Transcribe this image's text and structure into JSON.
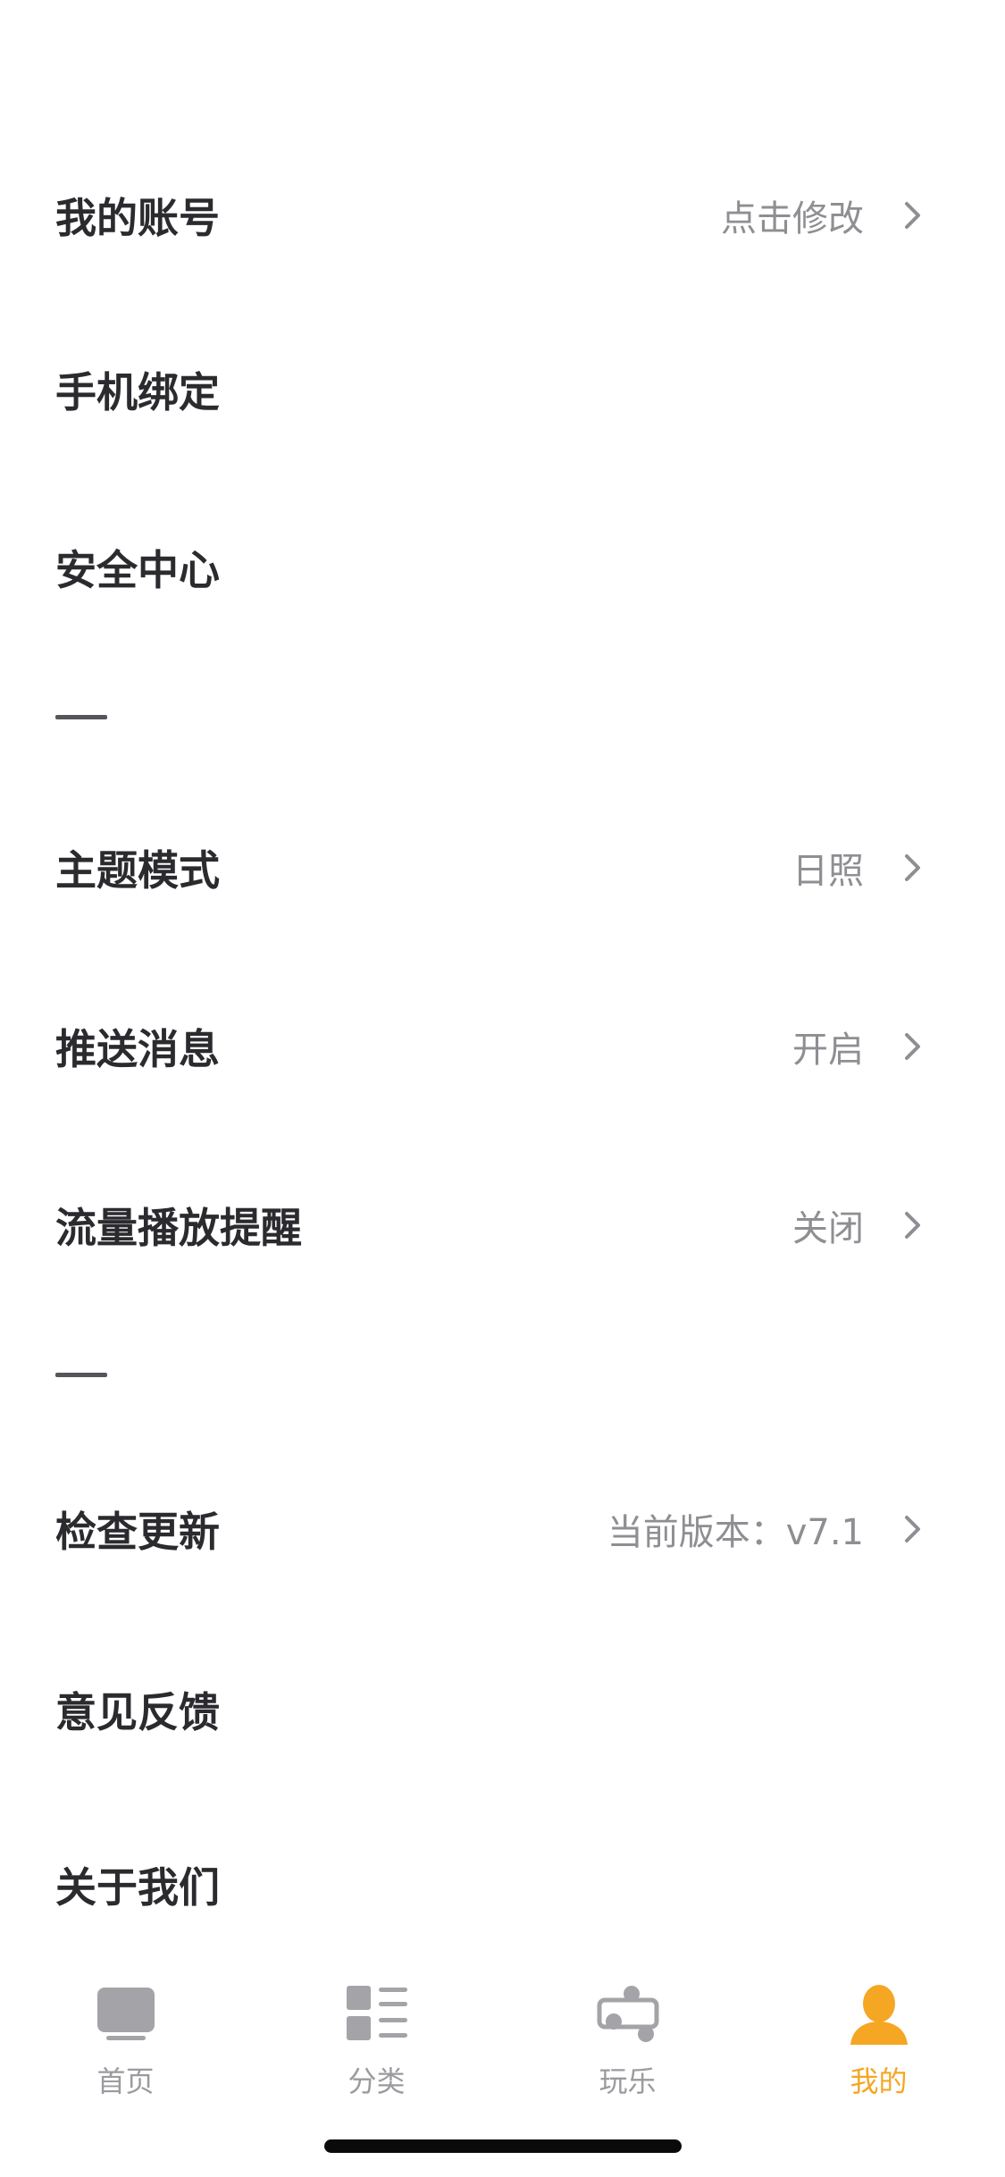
{
  "settings": {
    "account": {
      "label": "我的账号",
      "value": "点击修改"
    },
    "phone_binding": {
      "label": "手机绑定"
    },
    "security_center": {
      "label": "安全中心"
    },
    "theme_mode": {
      "label": "主题模式",
      "value": "日照"
    },
    "push_messages": {
      "label": "推送消息",
      "value": "开启"
    },
    "data_playback_alert": {
      "label": "流量播放提醒",
      "value": "关闭"
    },
    "check_update": {
      "label": "检查更新",
      "value": "当前版本：v7.1"
    },
    "feedback": {
      "label": "意见反馈"
    },
    "about_us": {
      "label": "关于我们"
    }
  },
  "tabbar": {
    "tabs": [
      {
        "label": "首页",
        "icon": "tv-icon",
        "active": false
      },
      {
        "label": "分类",
        "icon": "category-icon",
        "active": false
      },
      {
        "label": "玩乐",
        "icon": "fun-icon",
        "active": false
      },
      {
        "label": "我的",
        "icon": "person-icon",
        "active": true
      }
    ]
  },
  "colors": {
    "label_text": "#2b2b2f",
    "value_text": "#8e8e93",
    "chevron": "#8e8e93",
    "tab_inactive": "#9b9b9f",
    "tab_active": "#f5a623",
    "home_indicator": "#0a0a0a"
  }
}
